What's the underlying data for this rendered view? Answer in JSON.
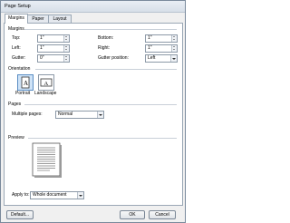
{
  "window": {
    "title": "Page Setup"
  },
  "tabs": [
    {
      "label": "Margins"
    },
    {
      "label": "Paper"
    },
    {
      "label": "Layout"
    }
  ],
  "margins": {
    "heading": "Margins",
    "top": {
      "label": "Top:",
      "value": "1\""
    },
    "bottom": {
      "label": "Bottom:",
      "value": "1\""
    },
    "left": {
      "label": "Left:",
      "value": "1\""
    },
    "right": {
      "label": "Right:",
      "value": "1\""
    },
    "gutter": {
      "label": "Gutter:",
      "value": "0\""
    },
    "gutter_position": {
      "label": "Gutter position:",
      "value": "Left"
    }
  },
  "orientation": {
    "heading": "Orientation",
    "portrait_label": "Portrait",
    "landscape_label": "Landscape"
  },
  "pages": {
    "heading": "Pages",
    "multiple_label": "Multiple pages:",
    "multiple_value": "Normal"
  },
  "preview": {
    "heading": "Preview"
  },
  "apply": {
    "label": "Apply to:",
    "value": "Whole document"
  },
  "buttons": {
    "default": "Default...",
    "ok": "OK",
    "cancel": "Cancel"
  }
}
